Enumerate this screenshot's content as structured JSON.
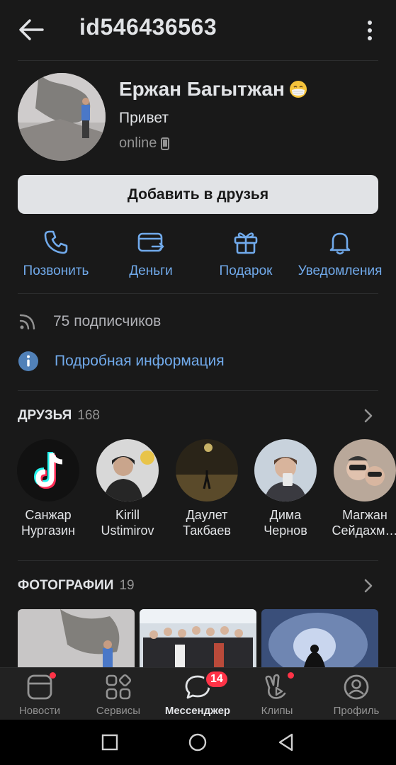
{
  "header": {
    "title": "id546436563"
  },
  "profile": {
    "name": "Ержан Багытжан",
    "status": "Привет",
    "online": "online",
    "add_button": "Добавить в друзья"
  },
  "actions": [
    {
      "label": "Позвонить",
      "icon": "phone-icon"
    },
    {
      "label": "Деньги",
      "icon": "money-transfer-icon"
    },
    {
      "label": "Подарок",
      "icon": "gift-icon"
    },
    {
      "label": "Уведомления",
      "icon": "bell-icon"
    }
  ],
  "info": {
    "followers": "75 подписчиков",
    "details_link": "Подробная информация"
  },
  "friends": {
    "title": "ДРУЗЬЯ",
    "count": "168",
    "items": [
      {
        "name": "Санжар\nНургазин"
      },
      {
        "name": "Kirill\nUstimirov"
      },
      {
        "name": "Даулет\nТакбаев"
      },
      {
        "name": "Дима\nЧернов"
      },
      {
        "name": "Магжан\nСейдахм…"
      }
    ]
  },
  "photos": {
    "title": "ФОТОГРАФИИ",
    "count": "19"
  },
  "tabbar": {
    "items": [
      {
        "label": "Новости",
        "icon": "news-icon"
      },
      {
        "label": "Сервисы",
        "icon": "services-icon"
      },
      {
        "label": "Мессенджер",
        "icon": "messenger-icon"
      },
      {
        "label": "Клипы",
        "icon": "clips-icon"
      },
      {
        "label": "Профиль",
        "icon": "profile-icon"
      }
    ],
    "messenger_badge": "14"
  },
  "colors": {
    "background": "#191919",
    "accent": "#71aaeb",
    "badge": "#ff3347",
    "button_bg": "#e1e3e6"
  }
}
